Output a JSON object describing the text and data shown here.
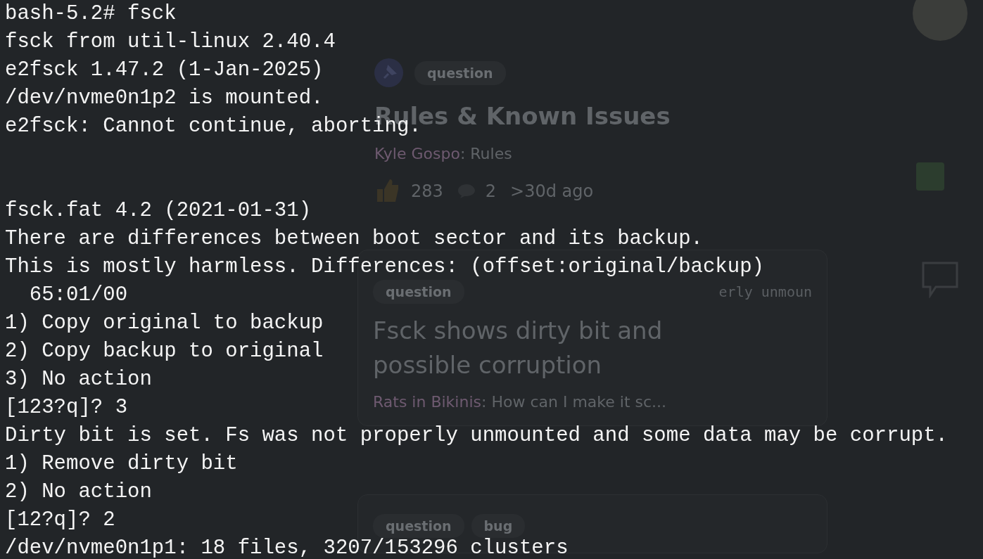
{
  "background": {
    "pinned_post": {
      "tag": "question",
      "title": "Rules & Known Issues",
      "author": "Kyle Gospo",
      "preview": ": Rules",
      "reactions": "283",
      "replies": "2",
      "age": ">30d ago"
    },
    "posts": [
      {
        "tags": [
          "question"
        ],
        "side_text": "erly unmoun",
        "title": "Fsck shows dirty bit and possible corruption",
        "author": "Rats in Bikinis",
        "preview": ": How can I make it sc..."
      },
      {
        "tags": [
          "question",
          "bug"
        ]
      }
    ]
  },
  "terminal": {
    "blocks": [
      {
        "lines": [
          "bash-5.2# fsck",
          "fsck from util-linux 2.40.4",
          "e2fsck 1.47.2 (1-Jan-2025)",
          "/dev/nvme0n1p2 is mounted.",
          "e2fsck: Cannot continue, aborting."
        ]
      },
      {
        "lines": [
          "fsck.fat 4.2 (2021-01-31)",
          "There are differences between boot sector and its backup.",
          "This is mostly harmless. Differences: (offset:original/backup)",
          "  65:01/00",
          "1) Copy original to backup",
          "2) Copy backup to original",
          "3) No action",
          "[123?q]? 3",
          "Dirty bit is set. Fs was not properly unmounted and some data may be corrupt.",
          "1) Remove dirty bit",
          "2) No action",
          "[12?q]? 2",
          "/dev/nvme0n1p1: 18 files, 3207/153296 clusters"
        ]
      }
    ]
  }
}
